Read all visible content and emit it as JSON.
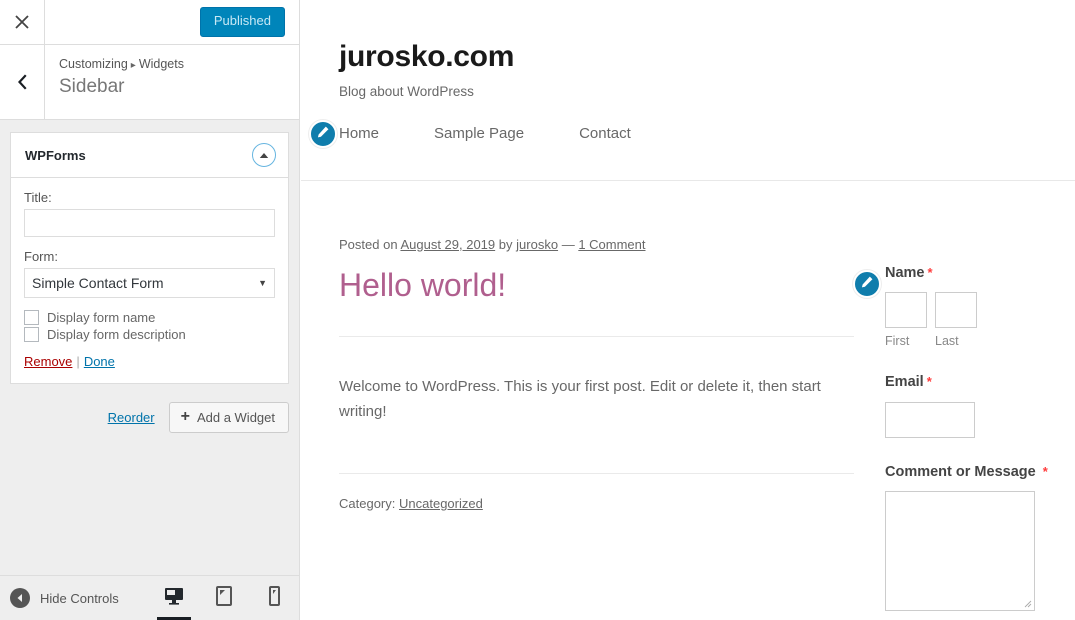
{
  "customizer": {
    "close_icon": "close-x-icon",
    "publish_button": "Published",
    "back_icon": "chevron-left-icon",
    "breadcrumb": {
      "root": "Customizing",
      "separator": "▸",
      "current": "Widgets"
    },
    "panel_title": "Sidebar",
    "widget": {
      "title": "WPForms",
      "toggle_icon": "caret-up-icon",
      "fields": {
        "title_label": "Title:",
        "title_value": "",
        "title_placeholder": "",
        "form_label": "Form:",
        "form_selected": "Simple Contact Form",
        "form_arrow_icon": "caret-down-icon",
        "checkbox_name": "Display form name",
        "checkbox_description": "Display form description"
      },
      "actions": {
        "remove": "Remove",
        "separator": "|",
        "done": "Done"
      }
    },
    "tools": {
      "reorder": "Reorder",
      "add_widget": "Add a Widget",
      "add_widget_icon": "plus-icon"
    },
    "footer": {
      "hide_controls": "Hide Controls",
      "hide_icon": "caret-left-circle-icon",
      "devices": [
        {
          "name": "desktop",
          "icon": "desktop-icon",
          "active": true
        },
        {
          "name": "tablet",
          "icon": "tablet-icon",
          "active": false
        },
        {
          "name": "mobile",
          "icon": "mobile-icon",
          "active": false
        }
      ]
    },
    "colors": {
      "accent": "#0085ba",
      "publish_text": "#c7e8f5",
      "remove_link": "#a00",
      "done_link": "#0073aa",
      "panel_bg": "#eeeeee"
    }
  },
  "preview": {
    "site_title": "jurosko.com",
    "site_description": "Blog about WordPress",
    "nav": [
      {
        "label": "Home"
      },
      {
        "label": "Sample Page"
      },
      {
        "label": "Contact"
      }
    ],
    "edit_icon": "pencil-edit-icon",
    "post": {
      "meta_posted_on": "Posted on",
      "meta_date": "August 29, 2019",
      "meta_by": "by",
      "meta_author": "jurosko",
      "meta_dash": "—",
      "meta_comments": "1 Comment",
      "title": "Hello world!",
      "body": "Welcome to WordPress. This is your first post. Edit or delete it, then start writing!",
      "category_label": "Category:",
      "category": "Uncategorized",
      "title_color": "#b05f8e"
    },
    "sidebar_form": {
      "name_label": "Name",
      "name_required": "*",
      "first_sublabel": "First",
      "last_sublabel": "Last",
      "email_label": "Email",
      "email_required": "*",
      "message_label": "Comment or Message",
      "message_required": "*",
      "first_value": "",
      "last_value": "",
      "email_value": "",
      "message_value": ""
    }
  }
}
